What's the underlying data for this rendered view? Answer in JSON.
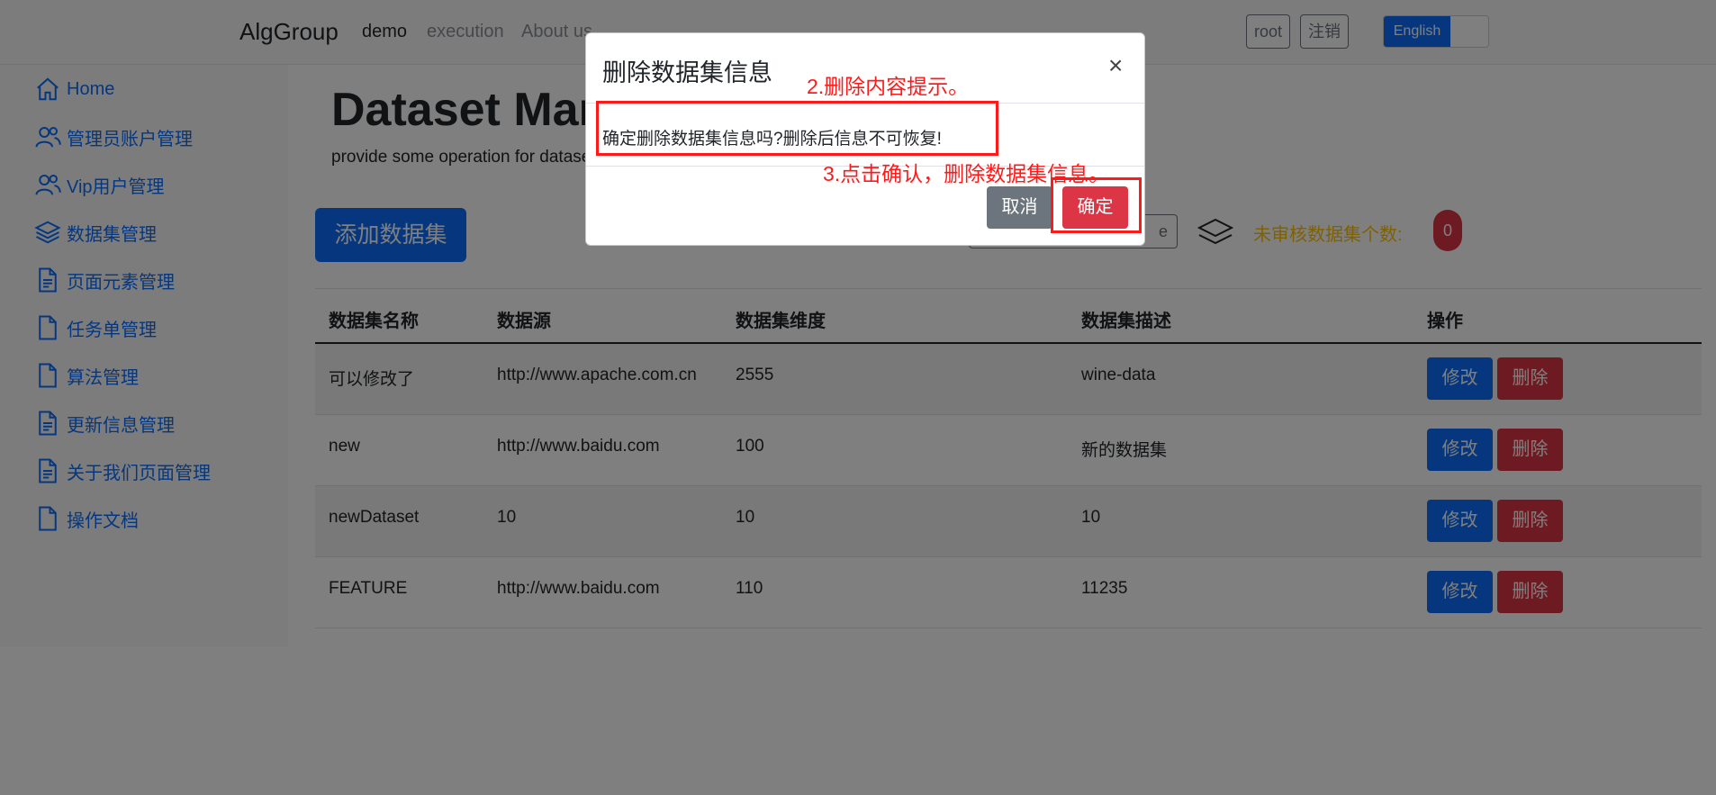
{
  "navbar": {
    "brand": "AlgGroup",
    "links": [
      "demo",
      "execution",
      "About us"
    ],
    "user_button": "root",
    "logout_button": "注销",
    "language": "English"
  },
  "sidebar": {
    "items": [
      {
        "label": "Home",
        "icon": "home-icon"
      },
      {
        "label": "管理员账户管理",
        "icon": "users-icon"
      },
      {
        "label": "Vip用户管理",
        "icon": "users-icon"
      },
      {
        "label": "数据集管理",
        "icon": "layers-icon"
      },
      {
        "label": "页面元素管理",
        "icon": "document-text-icon"
      },
      {
        "label": "任务单管理",
        "icon": "document-icon"
      },
      {
        "label": "算法管理",
        "icon": "document-icon"
      },
      {
        "label": "更新信息管理",
        "icon": "document-text-icon"
      },
      {
        "label": "关于我们页面管理",
        "icon": "document-text-icon"
      },
      {
        "label": "操作文档",
        "icon": "document-icon"
      }
    ]
  },
  "main": {
    "title": "Dataset Management",
    "subtitle": "provide some operation for dataset",
    "add_button": "添加数据集",
    "search_fragment": "e",
    "pending_label": "未审核数据集个数:",
    "pending_count": "0"
  },
  "table": {
    "headers": [
      "数据集名称",
      "数据源",
      "数据集维度",
      "数据集描述",
      "操作"
    ],
    "rows": [
      [
        "可以修改了",
        "http://www.apache.com.cn",
        "2555",
        "wine-data"
      ],
      [
        "new",
        "http://www.baidu.com",
        "100",
        "新的数据集"
      ],
      [
        "newDataset",
        "10",
        "10",
        "10"
      ],
      [
        "FEATURE",
        "http://www.baidu.com",
        "110",
        "11235"
      ]
    ],
    "edit_label": "修改",
    "delete_label": "删除"
  },
  "modal": {
    "title": "删除数据集信息",
    "close": "×",
    "message": "确定删除数据集信息吗?删除后信息不可恢复!",
    "cancel": "取消",
    "confirm": "确定"
  },
  "annotations": {
    "step2": "2.删除内容提示。",
    "step3": "3.点击确认，删除数据集信息。"
  },
  "colors": {
    "primary": "#0d6efd",
    "danger": "#dc3545",
    "secondary": "#6c757d",
    "warning": "#ffc107",
    "annotation": "#ff1a1a"
  }
}
